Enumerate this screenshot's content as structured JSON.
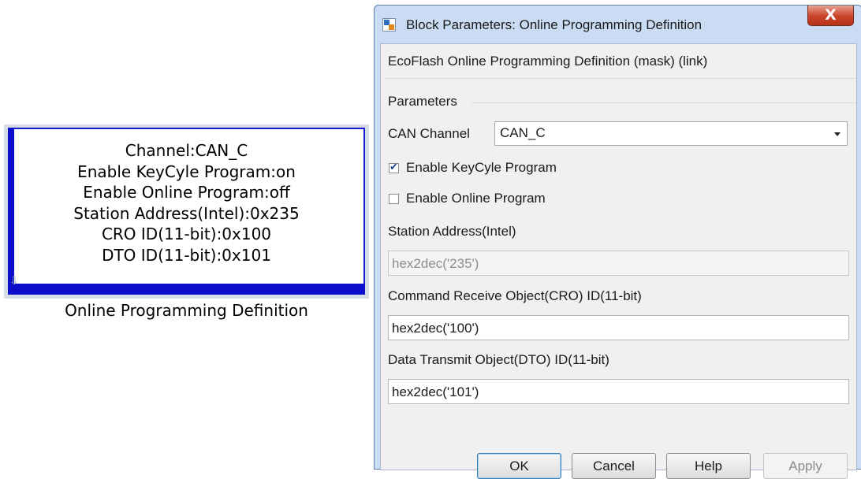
{
  "block": {
    "lines": [
      "Channel:CAN_C",
      "Enable KeyCyle Program:on",
      "Enable Online Program:off",
      "Station Address(Intel):0x235",
      "CRO ID(11-bit):0x100",
      "DTO ID(11-bit):0x101"
    ],
    "caption": "Online Programming Definition",
    "border_color": "#0d0dcc"
  },
  "dialog": {
    "title": "Block Parameters: Online Programming Definition",
    "close_glyph": "X",
    "mask_title": "EcoFlash Online Programming Definition (mask) (link)",
    "parameters_label": "Parameters",
    "can_channel": {
      "label": "CAN Channel",
      "value": "CAN_C"
    },
    "enable_keycycle": {
      "label": "Enable KeyCyle Program",
      "checked": true,
      "check_glyph": "✔"
    },
    "enable_online": {
      "label": "Enable Online Program",
      "checked": false
    },
    "station_address": {
      "label": "Station Address(Intel)",
      "value": "hex2dec('235')",
      "disabled": true
    },
    "cro_id": {
      "label": "Command Receive Object(CRO) ID(11-bit)",
      "value": "hex2dec('100')"
    },
    "dto_id": {
      "label": "Data Transmit Object(DTO) ID(11-bit)",
      "value": "hex2dec('101')"
    },
    "buttons": {
      "ok": "OK",
      "cancel": "Cancel",
      "help": "Help",
      "apply": "Apply"
    },
    "colors": {
      "title_bar": "#c9dcf3",
      "close_button": "#c8432a",
      "client": "#f0f0f0"
    }
  }
}
